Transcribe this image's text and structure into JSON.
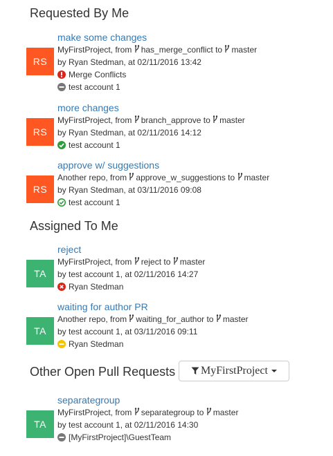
{
  "sections": {
    "requested": "Requested By Me",
    "assigned": "Assigned To Me",
    "other": "Other Open Pull Requests"
  },
  "filter": {
    "label": "MyFirstProject"
  },
  "prs": [
    {
      "initials": "RS",
      "title": "make some changes",
      "project": "MyFirstProject",
      "from_text": ", from ",
      "source": "has_merge_conflict",
      "to_text": " to ",
      "target": "master",
      "by_line": "by Ryan Stedman, at 02/11/2016 13:42",
      "status1": {
        "icon": "error-icon",
        "text": "Merge Conflicts"
      },
      "status2": {
        "icon": "minus-icon",
        "text": "test account 1"
      }
    },
    {
      "initials": "RS",
      "title": "more changes",
      "project": "MyFirstProject",
      "from_text": ", from ",
      "source": "branch_approve",
      "to_text": " to ",
      "target": "master",
      "by_line": "by Ryan Stedman, at 02/11/2016 14:12",
      "status1": {
        "icon": "check-filled-icon",
        "text": "test account 1"
      }
    },
    {
      "initials": "RS",
      "title": "approve w/ suggestions",
      "project": "Another repo",
      "from_text": ", from ",
      "source": "approve_w_suggestions",
      "to_text": " to ",
      "target": "master",
      "by_line": "by Ryan Stedman, at 03/11/2016 09:08",
      "status1": {
        "icon": "check-outline-icon",
        "text": "test account 1"
      }
    },
    {
      "initials": "TA",
      "title": "reject",
      "project": "MyFirstProject",
      "from_text": ", from ",
      "source": "reject",
      "to_text": " to ",
      "target": "master",
      "by_line": "by test account 1, at 02/11/2016 14:27",
      "status1": {
        "icon": "reject-icon",
        "text": "Ryan Stedman"
      }
    },
    {
      "initials": "TA",
      "title": "waiting for author PR",
      "project": "Another repo",
      "from_text": ", from ",
      "source": "waiting_for_author",
      "to_text": " to ",
      "target": "master",
      "by_line": "by test account 1, at 03/11/2016 09:11",
      "status1": {
        "icon": "waiting-icon",
        "text": "Ryan Stedman"
      }
    },
    {
      "initials": "TA",
      "title": "separategroup",
      "project": "MyFirstProject",
      "from_text": ", from ",
      "source": "separategroup",
      "to_text": " to ",
      "target": "master",
      "by_line": "by test account 1, at 02/11/2016 14:30",
      "status1": {
        "icon": "minus-icon",
        "text": "[MyFirstProject]\\GuestTeam"
      }
    }
  ],
  "colors": {
    "link": "#337ab7",
    "avatar_rs": "#ff5722",
    "avatar_ta": "#3cb371",
    "error": "#d9261c",
    "approved": "#2e9e3c",
    "waiting": "#f5c400",
    "neutral": "#777777"
  }
}
